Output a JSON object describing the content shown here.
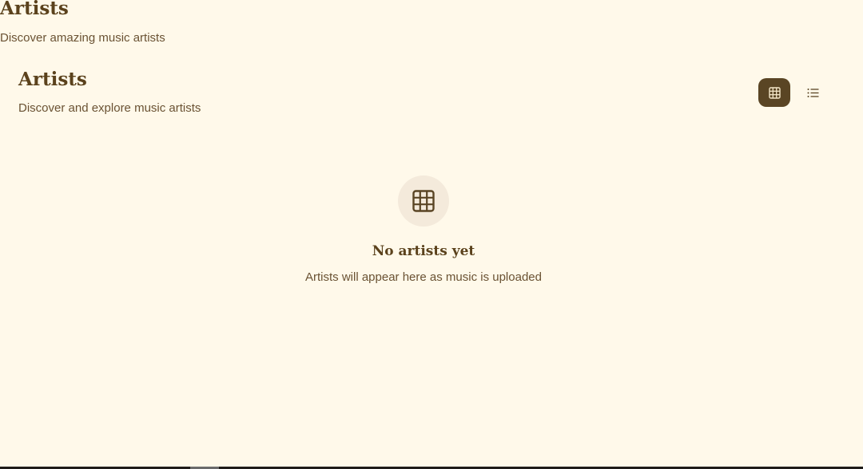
{
  "header": {
    "title": "Artists",
    "subtitle": "Discover amazing music artists"
  },
  "section": {
    "title": "Artists",
    "subtitle": "Discover and explore music artists"
  },
  "view_toggle": {
    "active": "grid",
    "grid_icon": "grid-icon",
    "list_icon": "list-icon"
  },
  "empty_state": {
    "icon": "grid-icon",
    "title": "No artists yet",
    "text": "Artists will appear here as music is uploaded"
  },
  "colors": {
    "background": "#fff9ea",
    "accent": "#5a4524",
    "text": "#5b421c",
    "icon_circle": "#f4eadb"
  }
}
